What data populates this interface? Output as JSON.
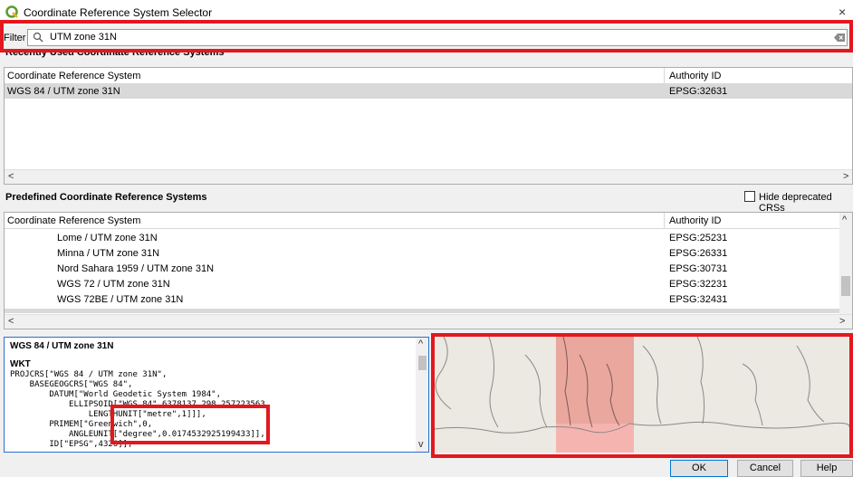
{
  "window": {
    "title": "Coordinate Reference System Selector",
    "close_glyph": "×"
  },
  "filter": {
    "label": "Filter",
    "value": "UTM zone 31N"
  },
  "recent": {
    "heading": "Recently Used Coordinate Reference Systems",
    "col_crs": "Coordinate Reference System",
    "col_auth": "Authority ID",
    "rows": [
      {
        "name": "WGS 84 / UTM zone 31N",
        "auth": "EPSG:32631",
        "selected": true
      }
    ]
  },
  "predefined": {
    "heading": "Predefined Coordinate Reference Systems",
    "hide_deprecated_label": "Hide deprecated CRSs",
    "hide_deprecated_checked": false,
    "col_crs": "Coordinate Reference System",
    "col_auth": "Authority ID",
    "rows": [
      {
        "name": "Lome / UTM zone 31N",
        "auth": "EPSG:25231"
      },
      {
        "name": "Minna / UTM zone 31N",
        "auth": "EPSG:26331"
      },
      {
        "name": "Nord Sahara 1959 / UTM zone 31N",
        "auth": "EPSG:30731"
      },
      {
        "name": "WGS 72 / UTM zone 31N",
        "auth": "EPSG:32231"
      },
      {
        "name": "WGS 72BE / UTM zone 31N",
        "auth": "EPSG:32431"
      }
    ]
  },
  "wkt": {
    "crs_name": "WGS 84 / UTM zone 31N",
    "label": "WKT",
    "lines": [
      "PROJCRS[\"WGS 84 / UTM zone 31N\",",
      "    BASEGEOGCRS[\"WGS 84\",",
      "        DATUM[\"World Geodetic System 1984\",",
      "            ELLIPSOID[\"WGS 84\",6378137,298.257223563,",
      "                LENGTHUNIT[\"metre\",1]]],",
      "        PRIMEM[\"Greenwich\",0,",
      "            ANGLEUNIT[\"degree\",0.0174532925199433]],",
      "        ID[\"EPSG\",4326]],"
    ]
  },
  "buttons": {
    "ok": "OK",
    "cancel": "Cancel",
    "help": "Help"
  },
  "arrows": {
    "left": "<",
    "right": ">",
    "up": "^",
    "down": "v"
  },
  "colors": {
    "highlight": "#e3171e",
    "selection": "#d9d9d9",
    "zone_fill": "#e8968c"
  },
  "icons": [
    "qgis-logo-icon",
    "search-icon",
    "clear-icon",
    "close-icon"
  ]
}
